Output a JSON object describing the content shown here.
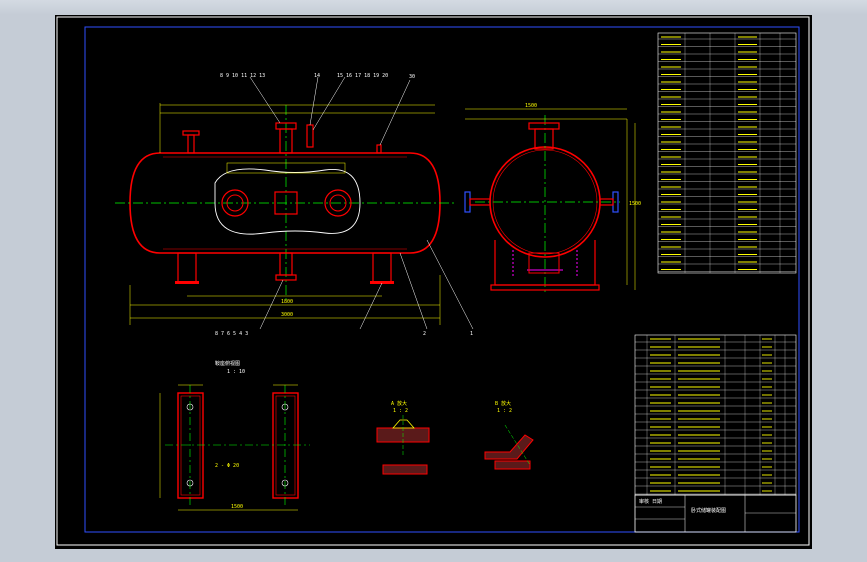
{
  "drawing": {
    "balloons_top_left": "8 9 10 11 12 13",
    "balloon_top_mid": "14",
    "balloons_top_right": "15 16 17 18 19 20",
    "balloon_top_far": "30",
    "balloons_bottom": "8 7 6 5 4 3",
    "balloon_b1": "2",
    "balloon_b2": "1",
    "total_length_dim": "3000",
    "support_span_dim": "1800",
    "left_view_label": "A",
    "right_view_label": "B",
    "side_dim": "1500",
    "side_height_dim": "1500",
    "saddle_title": "鞍座俯视图",
    "saddle_scale": "1 : 10",
    "saddle_width_dim": "1500",
    "saddle_hole_dim": "2 - Φ 20",
    "detail1_title": "A 放大",
    "detail1_scale": "1 : 2",
    "detail2_title": "B 放大",
    "detail2_scale": "1 : 2",
    "title_block_name": "卧式储罐装配图",
    "title_block_sub": "审核 日期"
  },
  "colors": {
    "vessel": "#ff0000",
    "dims": "#ffff00",
    "centerline": "#00ff00",
    "frame": "#0000ff",
    "table": "#ffffff",
    "nozzle": "#ff00ff"
  }
}
